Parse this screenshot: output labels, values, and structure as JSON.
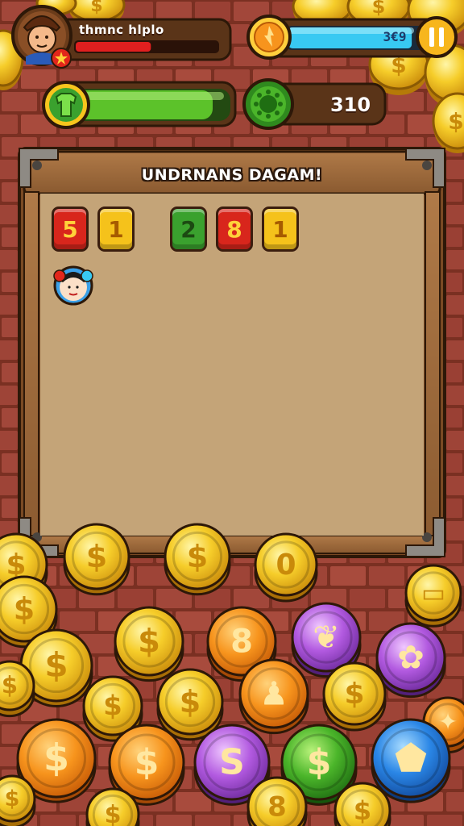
{
  "hud": {
    "player_name": "thmnc hlplo",
    "health_fraction": 0.53,
    "coin_count": "3€9",
    "level_fraction": 0.88,
    "gem_count": "310",
    "energy_fraction": 0.9
  },
  "board": {
    "title": "UNDRNANS DAGAM!",
    "tiles": [
      {
        "value": "5",
        "color": "red"
      },
      {
        "value": "1",
        "color": "yellow"
      },
      {
        "value": "2",
        "color": "green"
      },
      {
        "value": "8",
        "color": "red"
      },
      {
        "value": "1",
        "color": "yellow"
      }
    ]
  },
  "colors": {
    "brick": "#9a3f2e",
    "wood": "#9b6a3f",
    "panel": "#c7a77a",
    "health": "#e01f1f",
    "level": "#38c9f2",
    "energy": "#5cc22a",
    "gold": "#f2c320"
  },
  "icons": {
    "avatar": "player-portrait-icon",
    "shield": "badge-star-icon",
    "coin_badge": "coin-badge-icon",
    "pause": "pause-icon",
    "boost": "green-shirt-icon",
    "gem": "green-gem-icon"
  }
}
